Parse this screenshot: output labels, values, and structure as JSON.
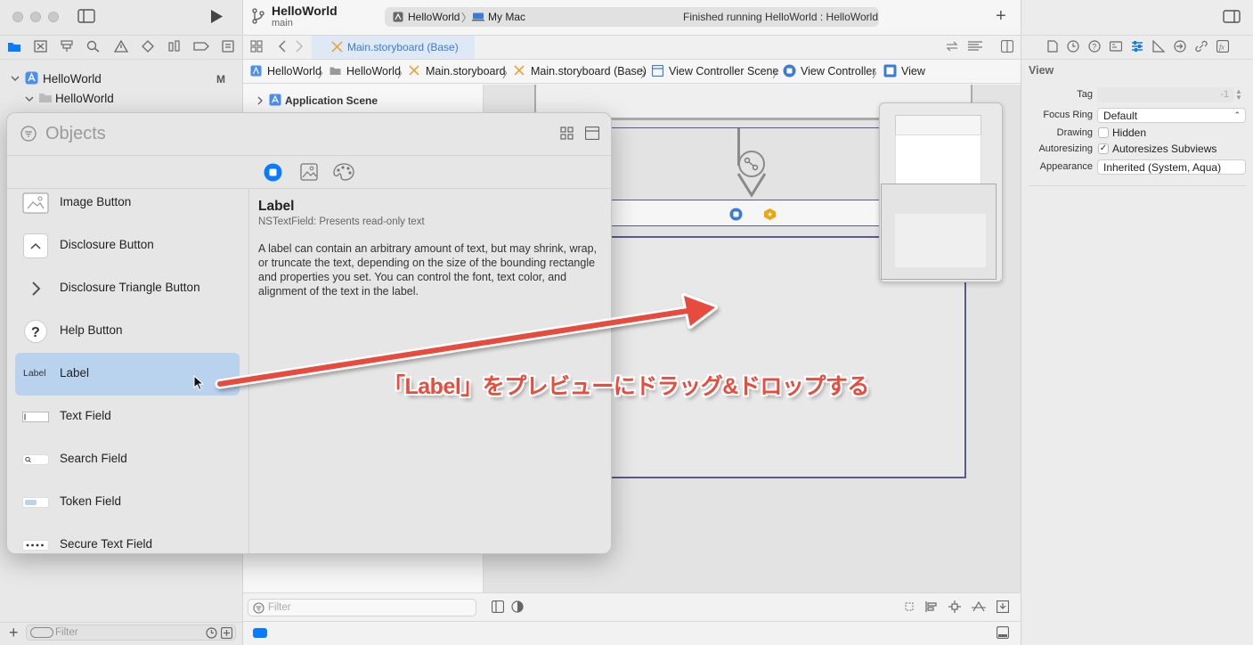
{
  "window": {
    "project_title": "HelloWorld",
    "branch": "main",
    "scheme": "HelloWorld",
    "destination": "My Mac",
    "status": "Finished running HelloWorld : HelloWorld"
  },
  "editor_tab": {
    "label": "Main.storyboard (Base)"
  },
  "breadcrumb": [
    "HelloWorld",
    "HelloWorld",
    "Main.storyboard",
    "Main.storyboard (Base)",
    "View Controller Scene",
    "View Controller",
    "View"
  ],
  "navigator": {
    "root": "HelloWorld",
    "root_badge": "M",
    "group": "HelloWorld",
    "filter_placeholder": "Filter"
  },
  "outline": {
    "scene": "Application Scene",
    "filter_placeholder": "Filter"
  },
  "objects_panel": {
    "title": "Objects",
    "items": [
      {
        "label": "Image Button",
        "icon": "image-button-icon"
      },
      {
        "label": "Disclosure Button",
        "icon": "disclosure-button-icon"
      },
      {
        "label": "Disclosure Triangle Button",
        "icon": "disclosure-triangle-icon"
      },
      {
        "label": "Help Button",
        "icon": "help-button-icon"
      },
      {
        "label": "Label",
        "icon_text": "Label",
        "selected": true
      },
      {
        "label": "Text Field",
        "icon": "text-field-icon"
      },
      {
        "label": "Search Field",
        "icon": "search-field-icon"
      },
      {
        "label": "Token Field",
        "icon": "token-field-icon"
      },
      {
        "label": "Secure Text Field",
        "icon": "secure-text-field-icon"
      }
    ],
    "detail": {
      "title": "Label",
      "subtitle": "NSTextField: Presents read-only text",
      "description": "A label can contain an arbitrary amount of text, but may shrink, wrap, or truncate the text, depending on the size of the bounding rectangle and properties you set. You can control the font, text color, and alignment of the text in the label."
    }
  },
  "inspector": {
    "section": "View",
    "tag_label": "Tag",
    "tag_value": "-1",
    "focus_ring_label": "Focus Ring",
    "focus_ring_value": "Default",
    "drawing_label": "Drawing",
    "hidden_label": "Hidden",
    "autoresizing_label": "Autoresizing",
    "autoresizes_label": "Autoresizes Subviews",
    "appearance_label": "Appearance",
    "appearance_value": "Inherited (System, Aqua)"
  },
  "annotation": "「Label」をプレビューにドラッグ&ドロップする",
  "colors": {
    "accent": "#0a7aff",
    "selection": "#b9d2ee",
    "annotation_red": "#e74c3c",
    "window_border": "#4a4a8a"
  }
}
